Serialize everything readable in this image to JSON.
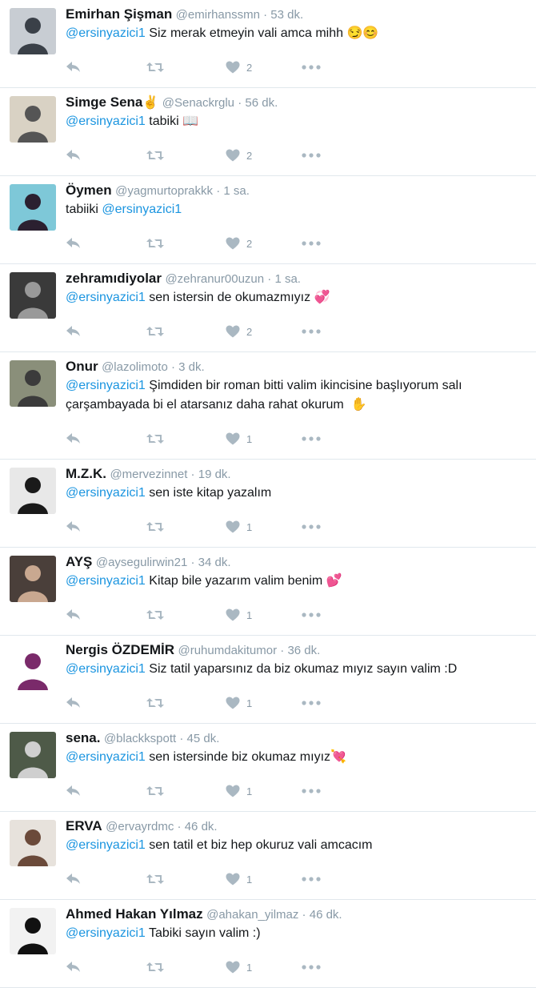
{
  "colors": {
    "mention": "#1b95e0",
    "icon": "#aab8c2",
    "meta": "#8899a6"
  },
  "tweets": [
    {
      "name": "Emirhan Şişman",
      "handle": "@emirhanssmn",
      "time": "53 dk.",
      "parts": [
        {
          "m": "@ersinyazici1"
        },
        {
          "t": " Siz merak etmeyin vali amca mihh "
        },
        {
          "e": "😏😊"
        }
      ],
      "likes": "2",
      "avatar": {
        "bg": "#c8cdd3",
        "fg": "#3a4048"
      }
    },
    {
      "name": "Simge Sena",
      "badge": "✌",
      "handle": "@Senackrglu",
      "time": "56 dk.",
      "parts": [
        {
          "m": "@ersinyazici1"
        },
        {
          "t": " tabiki "
        },
        {
          "e": "📖"
        }
      ],
      "likes": "2",
      "avatar": {
        "bg": "#d9d2c4",
        "fg": "#555"
      }
    },
    {
      "name": "Öymen",
      "handle": "@yagmurtoprakkk",
      "time": "1 sa.",
      "parts": [
        {
          "t": "tabiiki "
        },
        {
          "m": "@ersinyazici1"
        }
      ],
      "likes": "2",
      "avatar": {
        "bg": "#7ec8d8",
        "fg": "#2b2030"
      }
    },
    {
      "name": "zehramıdiyolar",
      "handle": "@zehranur00uzun",
      "time": "1 sa.",
      "parts": [
        {
          "m": "@ersinyazici1"
        },
        {
          "t": " sen istersin de okumazmıyız "
        },
        {
          "e": "💞"
        }
      ],
      "likes": "2",
      "avatar": {
        "bg": "#3a3a3a",
        "fg": "#999"
      }
    },
    {
      "name": "Onur",
      "handle": "@lazolimoto",
      "time": "3 dk.",
      "parts": [
        {
          "m": "@ersinyazici1"
        },
        {
          "t": " Şimdiden bir roman bitti valim ikincisine başlıyorum salı çarşambayada bi el atarsanız daha rahat okurum  "
        },
        {
          "e": "✋"
        }
      ],
      "likes": "1",
      "tall": true,
      "avatar": {
        "bg": "#8a8f7a",
        "fg": "#3b3b3b"
      }
    },
    {
      "name": "M.Z.K.",
      "handle": "@mervezinnet",
      "time": "19 dk.",
      "parts": [
        {
          "m": "@ersinyazici1"
        },
        {
          "t": " sen iste kitap yazalım"
        }
      ],
      "likes": "1",
      "avatar": {
        "bg": "#e8e8e8",
        "fg": "#1a1a1a"
      }
    },
    {
      "name": "AYŞ",
      "handle": "@aysegulirwin21",
      "time": "34 dk.",
      "parts": [
        {
          "m": "@ersinyazici1"
        },
        {
          "t": " Kitap bile yazarım valim benim "
        },
        {
          "e": "💕"
        }
      ],
      "likes": "1",
      "avatar": {
        "bg": "#4a3f3a",
        "fg": "#c9a890"
      }
    },
    {
      "name": "Nergis ÖZDEMİR",
      "handle": "@ruhumdakitumor",
      "time": "36 dk.",
      "parts": [
        {
          "m": "@ersinyazici1"
        },
        {
          "t": " Siz tatil yaparsınız da biz okumaz mıyız sayın valim :D"
        }
      ],
      "likes": "1",
      "avatar": {
        "bg": "#ffffff",
        "fg": "#7a2a6a"
      }
    },
    {
      "name": "sena.",
      "handle": "@blackkspott",
      "time": "45 dk.",
      "parts": [
        {
          "m": "@ersinyazici1"
        },
        {
          "t": " sen istersinde biz okumaz mıyız"
        },
        {
          "e": "💘"
        }
      ],
      "likes": "1",
      "avatar": {
        "bg": "#4e5a48",
        "fg": "#cfcfcf"
      }
    },
    {
      "name": "ERVA",
      "handle": "@ervayrdmc",
      "time": "46 dk.",
      "parts": [
        {
          "m": "@ersinyazici1"
        },
        {
          "t": " sen tatil et biz hep okuruz vali amcacım"
        }
      ],
      "likes": "1",
      "avatar": {
        "bg": "#e7e2dc",
        "fg": "#6b4a3a"
      }
    },
    {
      "name": "Ahmed Hakan Yılmaz",
      "handle": "@ahakan_yilmaz",
      "time": "46 dk.",
      "parts": [
        {
          "m": "@ersinyazici1"
        },
        {
          "t": " Tabiki sayın valim :)"
        }
      ],
      "likes": "1",
      "avatar": {
        "bg": "#f2f2f2",
        "fg": "#111"
      }
    }
  ]
}
